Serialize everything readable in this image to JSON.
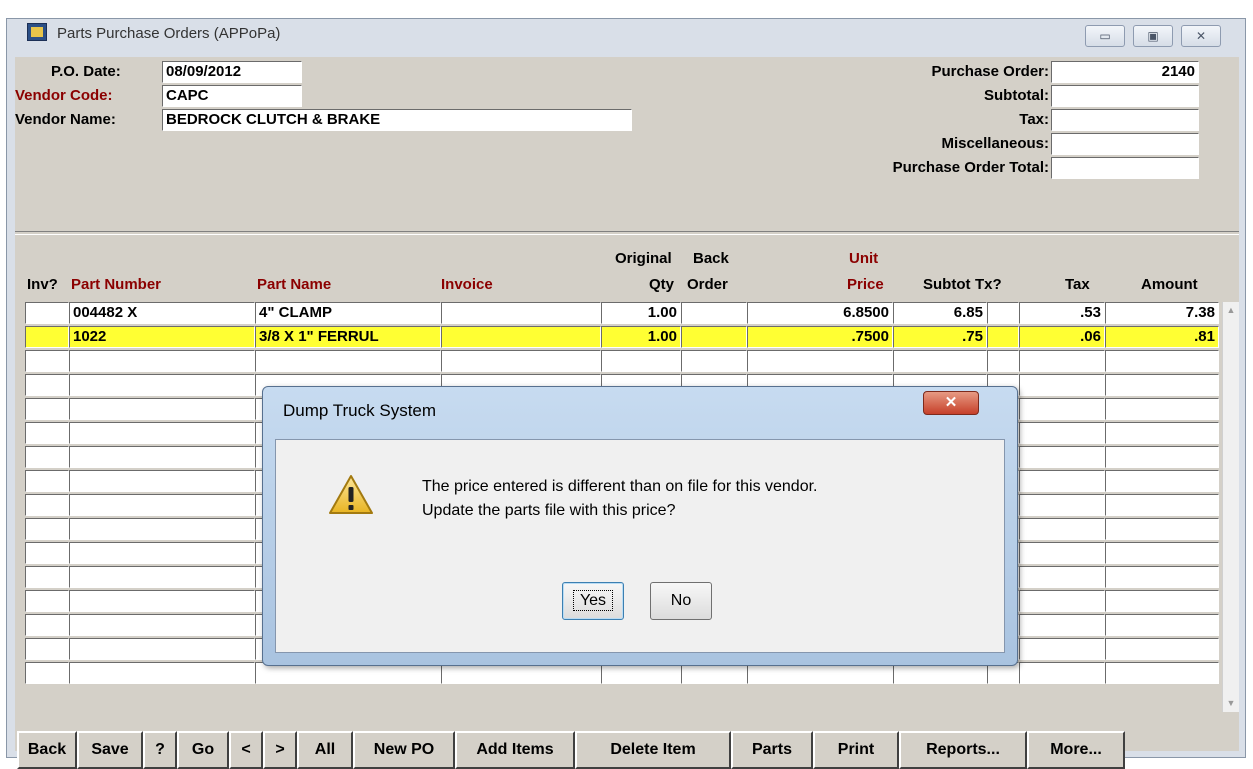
{
  "window": {
    "title": "Parts Purchase Orders (APPoPa)",
    "controls": [
      "▭",
      "▣",
      "✕"
    ]
  },
  "header": {
    "po_date_label": "P.O. Date:",
    "po_date": "08/09/2012",
    "vendor_code_label": "Vendor Code:",
    "vendor_code": "CAPC",
    "vendor_name_label": "Vendor Name:",
    "vendor_name": "BEDROCK CLUTCH & BRAKE",
    "purchase_order_label": "Purchase Order:",
    "purchase_order": "2140",
    "subtotal_label": "Subtotal:",
    "subtotal": "",
    "tax_label": "Tax:",
    "tax": "",
    "misc_label": "Miscellaneous:",
    "misc": "",
    "total_label": "Purchase Order Total:",
    "total": ""
  },
  "grid": {
    "columns": {
      "inv": "Inv?",
      "part_number": "Part Number",
      "part_name": "Part Name",
      "invoice": "Invoice",
      "orig_qty_1": "Original",
      "orig_qty_2": "Qty",
      "back_order_1": "Back",
      "back_order_2": "Order",
      "unit_price_1": "Unit",
      "unit_price_2": "Price",
      "subtot": "Subtot",
      "tx": "Tx?",
      "tax": "Tax",
      "amount": "Amount"
    },
    "rows": [
      {
        "inv": "",
        "part_number": "004482 X",
        "part_name": "4\" CLAMP",
        "invoice": "",
        "qty": "1.00",
        "back_order": "",
        "unit_price": "6.8500",
        "subtot": "6.85",
        "tx": "",
        "tax": ".53",
        "amount": "7.38"
      },
      {
        "inv": "",
        "part_number": "1022",
        "part_name": "3/8 X 1\" FERRUL",
        "invoice": "",
        "qty": "1.00",
        "back_order": "",
        "unit_price": ".7500",
        "subtot": ".75",
        "tx": "",
        "tax": ".06",
        "amount": ".81"
      }
    ],
    "highlight_color": "#ffff33"
  },
  "toolbar": {
    "back": "Back",
    "save": "Save",
    "help": "?",
    "go": "Go",
    "prev": "<",
    "next": ">",
    "all": "All",
    "new_po": "New PO",
    "add_items": "Add Items",
    "delete_item": "Delete Item",
    "parts": "Parts",
    "print": "Print",
    "reports": "Reports...",
    "more": "More..."
  },
  "dialog": {
    "title": "Dump Truck System",
    "close": "✕",
    "icon": "warning-icon",
    "line1": "The price entered is different than on file for this vendor.",
    "line2": "Update the parts file with this price?",
    "yes": "Yes",
    "no": "No"
  },
  "colors": {
    "label_red": "#8b0000",
    "window_bg": "#d4d0c8"
  }
}
